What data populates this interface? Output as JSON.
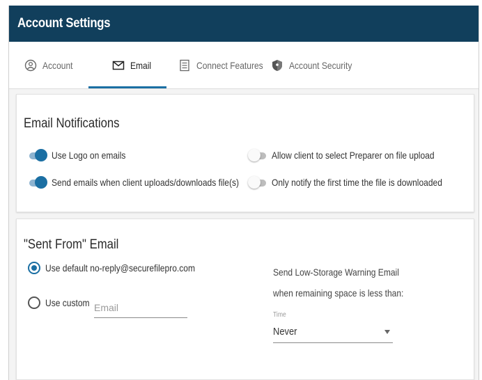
{
  "header": {
    "title": "Account Settings"
  },
  "tabs": [
    {
      "label": "Account",
      "icon": "account-circle-icon"
    },
    {
      "label": "Email",
      "icon": "mail-icon"
    },
    {
      "label": "Connect Features",
      "icon": "list-icon"
    },
    {
      "label": "Account Security",
      "icon": "shield-icon"
    }
  ],
  "active_tab": "Email",
  "notifications": {
    "title": "Email Notifications",
    "toggles": [
      {
        "label": "Use Logo on emails",
        "on": true
      },
      {
        "label": "Send emails when client uploads/downloads file(s)",
        "on": true
      },
      {
        "label": "Allow client to select Preparer on file upload",
        "on": false
      },
      {
        "label": "Only notify the first time the file is downloaded",
        "on": false
      }
    ]
  },
  "sent_from": {
    "title": "\"Sent From\" Email",
    "default_option": "Use default no-reply@securefilepro.com",
    "custom_option": "Use custom",
    "email_placeholder": "Email",
    "selected": "default"
  },
  "low_storage": {
    "line1": "Send Low-Storage Warning Email",
    "line2": "when remaining space is less than:",
    "field_label": "Time",
    "value": "Never"
  },
  "colors": {
    "header": "#113f5c",
    "accent": "#1b6fa3"
  }
}
